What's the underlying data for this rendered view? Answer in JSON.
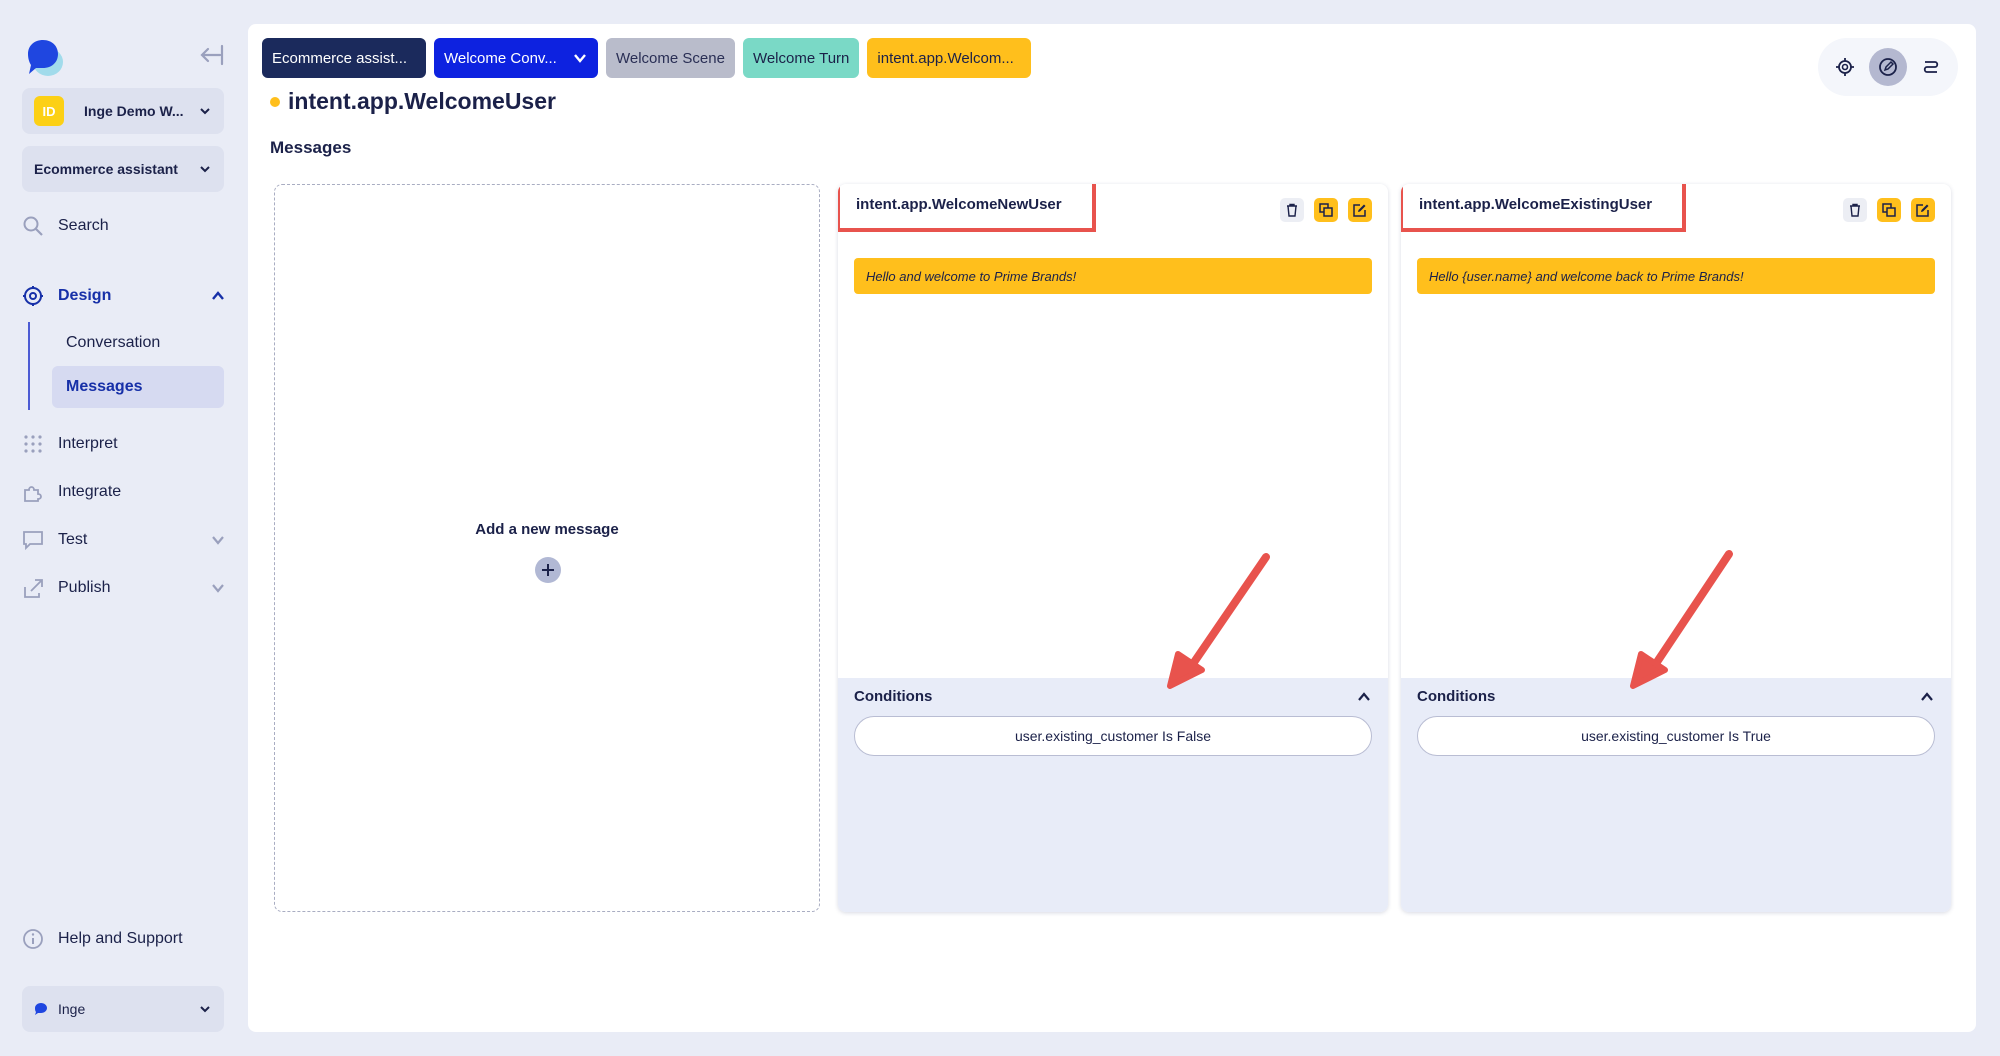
{
  "sidebar": {
    "workspace": {
      "initials": "ID",
      "name": "Inge Demo W..."
    },
    "project": {
      "name": "Ecommerce assistant"
    },
    "nav": {
      "search": "Search",
      "design": "Design",
      "conversation": "Conversation",
      "messages": "Messages",
      "interpret": "Interpret",
      "integrate": "Integrate",
      "test": "Test",
      "publish": "Publish",
      "help": "Help and Support"
    },
    "user": {
      "name": "Inge"
    }
  },
  "breadcrumbs": {
    "c1": "Ecommerce assist...",
    "c2": "Welcome Conv...",
    "c3": "Welcome Scene",
    "c4": "Welcome Turn",
    "c5": "intent.app.Welcom..."
  },
  "page": {
    "title": "intent.app.WelcomeUser",
    "section": "Messages",
    "add_message": "Add a new message"
  },
  "cards": [
    {
      "name": "intent.app.WelcomeNewUser",
      "message": "Hello and welcome to Prime Brands!",
      "conditions_title": "Conditions",
      "condition": "user.existing_customer Is False"
    },
    {
      "name": "intent.app.WelcomeExistingUser",
      "message": "Hello {user.name} and welcome back to Prime Brands!",
      "conditions_title": "Conditions",
      "condition": "user.existing_customer Is True"
    }
  ],
  "colors": {
    "accent": "#1730a8",
    "message_yellow": "#ffbf1c",
    "highlight_red": "#e8534d",
    "breadcrumb_teal": "#7ad9c6",
    "breadcrumb_blue": "#0d22e0"
  },
  "icons": [
    "logo-icon",
    "collapse-sidebar-icon",
    "search-icon",
    "design-icon",
    "interpret-icon",
    "integrate-icon",
    "test-icon",
    "publish-icon",
    "help-icon",
    "trash-icon",
    "copy-icon",
    "edit-icon",
    "plus-icon",
    "chevron-down-icon",
    "chevron-up-icon"
  ]
}
